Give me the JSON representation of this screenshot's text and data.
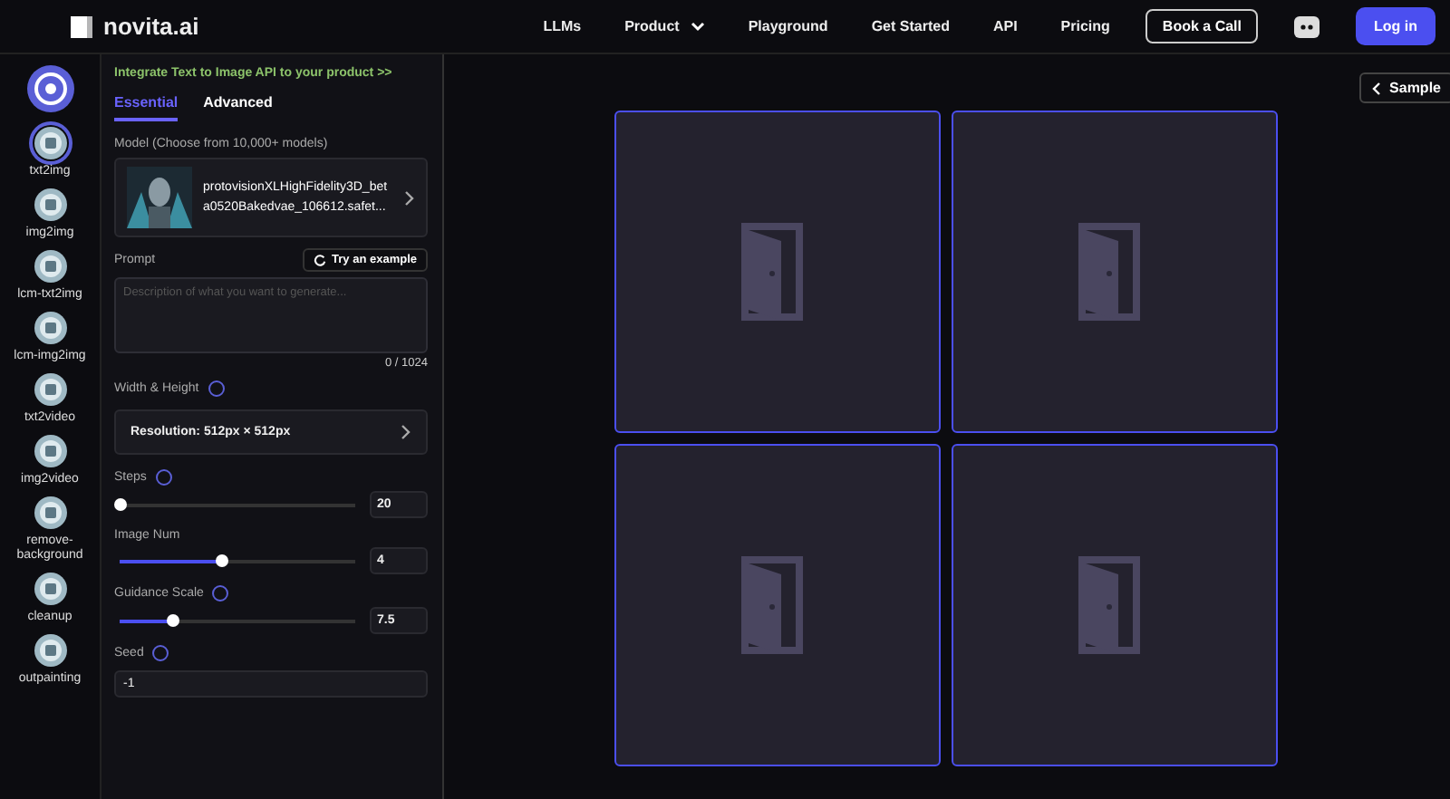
{
  "header": {
    "brand": "novita.ai",
    "nav": [
      {
        "label": "LLMs",
        "dropdown": false
      },
      {
        "label": "Product",
        "dropdown": true
      },
      {
        "label": "Playground",
        "dropdown": false
      },
      {
        "label": "Get Started",
        "dropdown": false
      },
      {
        "label": "API",
        "dropdown": false
      },
      {
        "label": "Pricing",
        "dropdown": false
      }
    ],
    "book_call": "Book a Call",
    "login": "Log in"
  },
  "sidebar": {
    "items": [
      {
        "label": "txt2img",
        "selected": true
      },
      {
        "label": "img2img",
        "selected": false
      },
      {
        "label": "lcm-txt2img",
        "selected": false
      },
      {
        "label": "lcm-img2img",
        "selected": false
      },
      {
        "label": "txt2video",
        "selected": false
      },
      {
        "label": "img2video",
        "selected": false
      },
      {
        "label": "remove-background",
        "selected": false
      },
      {
        "label": "cleanup",
        "selected": false
      },
      {
        "label": "outpainting",
        "selected": false
      }
    ]
  },
  "panel": {
    "api_link": "Integrate Text to Image API to your product >>",
    "tabs": [
      {
        "label": "Essential",
        "selected": true
      },
      {
        "label": "Advanced",
        "selected": false
      }
    ],
    "model_label": "Model (Choose from 10,000+ models)",
    "model_name": "protovisionXLHighFidelity3D_beta0520Bakedvae_106612.safet...",
    "prompt_label": "Prompt",
    "try_example": "Try an example",
    "prompt_placeholder": "Description of what you want to generate...",
    "prompt_count": "0 / 1024",
    "size_label": "Width & Height",
    "resolution": "Resolution: 512px × 512px",
    "sliders": [
      {
        "label": "Steps",
        "help": true,
        "level": 0.0,
        "value": "20"
      },
      {
        "label": "Image Num",
        "help": false,
        "level": 0.43,
        "value": "4"
      },
      {
        "label": "Guidance Scale",
        "help": true,
        "level": 0.22,
        "value": "7.5"
      }
    ],
    "seed_label": "Seed",
    "seed_value": "-1"
  },
  "main": {
    "sample_button": "Sample",
    "images": [
      {
        "kind": "placeholder"
      },
      {
        "kind": "placeholder"
      },
      {
        "kind": "placeholder"
      },
      {
        "kind": "placeholder"
      }
    ]
  }
}
